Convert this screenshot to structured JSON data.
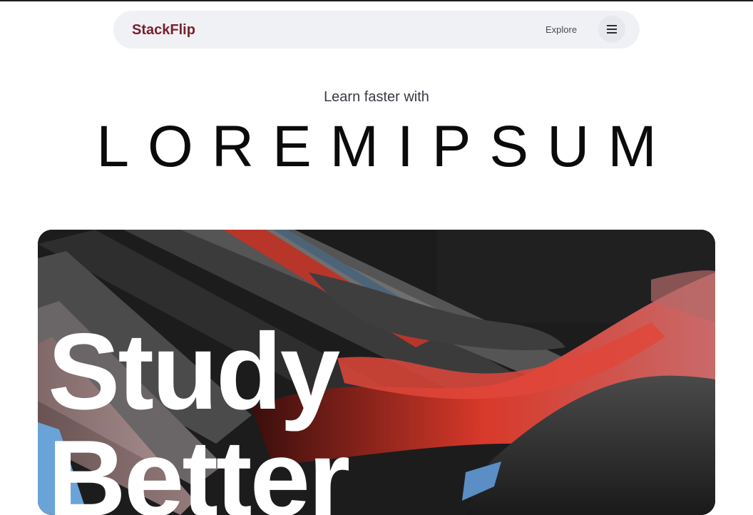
{
  "navbar": {
    "brand": "StackFlip",
    "explore_label": "Explore",
    "menu_icon": "hamburger-menu-icon"
  },
  "hero_intro": {
    "eyebrow": "Learn faster with",
    "headline": "LOREMIPSUM"
  },
  "hero_card": {
    "title_line1": "Study",
    "title_line2": "Better"
  },
  "colors": {
    "brand": "#7a1f2b",
    "nav_bg": "#eff1f5",
    "accent_red": "#d8392a"
  }
}
